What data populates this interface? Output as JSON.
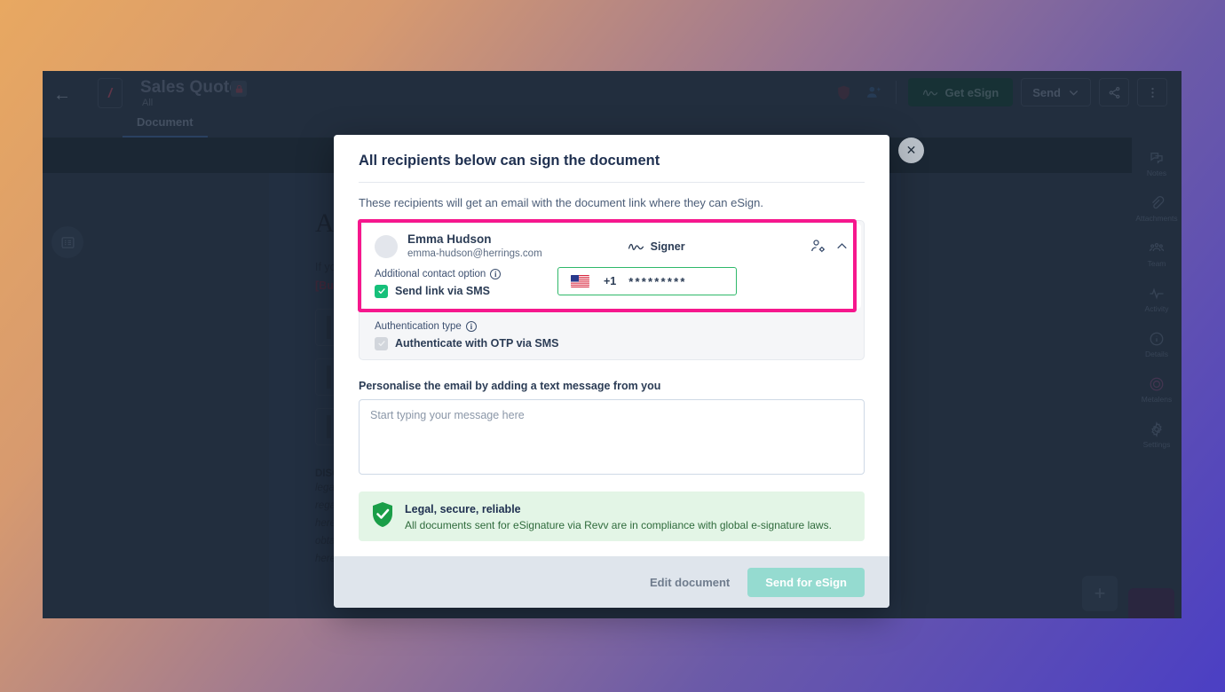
{
  "app": {
    "back_icon": "back-arrow-icon",
    "doc_badge": "/",
    "title": "Sales Quote",
    "subtitle": "All",
    "lock_icon": "lock-icon",
    "tabs": [
      {
        "label": "Document",
        "active": true
      }
    ],
    "toolbar": {
      "shield_icon": "shield-icon",
      "add_user_icon": "add-user-icon",
      "get_esign_label": "Get eSign",
      "get_esign_icon": "signature-icon",
      "send_label": "Send",
      "send_caret": "chevron-down-icon",
      "share_icon": "share-icon",
      "more_icon": "kebab-menu-icon"
    },
    "toc_icon": "list-view-icon",
    "fab_plus": "+",
    "right_rail": [
      {
        "label": "Notes",
        "icon": "notes-icon"
      },
      {
        "label": "Attachments",
        "icon": "paperclip-icon"
      },
      {
        "label": "Team",
        "icon": "team-icon"
      },
      {
        "label": "Activity",
        "icon": "activity-pulse-icon"
      },
      {
        "label": "Details",
        "icon": "info-circle-icon"
      },
      {
        "label": "Metalens",
        "icon": "metalens-icon"
      },
      {
        "label": "Settings",
        "icon": "gear-icon"
      }
    ]
  },
  "document_preview": {
    "heading": "Acceptance",
    "paragraph_1": "If you agree with the quotation above,",
    "paragraph_tag": "[Buyer.Company]",
    "disclaimer_heading": "DISCLAIMER",
    "disclaimer_lines": [
      "legal advice of any kind. The information",
      "regarding the terms and conditions set out",
      "hereof. The parties acknowledge that they have",
      "obtained independent legal advice in respect",
      "here."
    ]
  },
  "modal": {
    "close_icon": "close-icon",
    "title": "All recipients below can sign the document",
    "subtitle": "These recipients will get an email with the document link where they can eSign.",
    "recipient": {
      "avatar": "avatar",
      "name": "Emma Hudson",
      "email": "emma-hudson@herrings.com",
      "role_icon": "signature-icon",
      "role": "Signer",
      "manage_icon": "person-settings-icon",
      "collapse_icon": "chevron-up-icon",
      "contact_option_label": "Additional contact option",
      "contact_option_info": "info-icon",
      "sms_checkbox_label": "Send link via SMS",
      "sms_checked": true,
      "phone": {
        "flag": "us-flag-icon",
        "country_code": "+1",
        "value": "*********"
      },
      "auth_label": "Authentication type",
      "auth_info": "info-icon",
      "auth_checkbox_label": "Authenticate with OTP via SMS",
      "auth_checked": true
    },
    "personalise_label": "Personalise the email by adding a text message from you",
    "message_placeholder": "Start typing your message here",
    "message_value": "",
    "legal": {
      "icon": "shield-check-icon",
      "title": "Legal, secure, reliable",
      "text": "All documents sent for eSignature via Revv are in compliance with global e-signature laws."
    },
    "footer": {
      "edit_label": "Edit document",
      "send_label": "Send for eSign"
    }
  },
  "colors": {
    "highlight_pink": "#f6178d",
    "field_green": "#2fb86a",
    "checkbox_green": "#16c07a",
    "primary_button": "#95dbd0",
    "app_chrome": "#2e3c50"
  }
}
